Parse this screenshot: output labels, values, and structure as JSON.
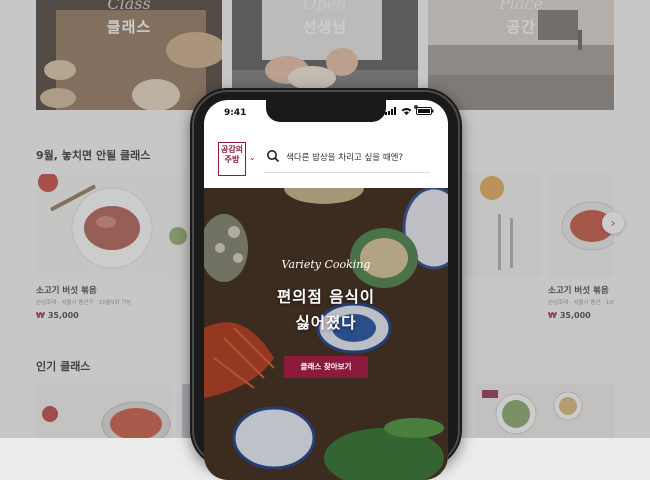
{
  "banner": [
    {
      "script": "Class",
      "title": "클래스"
    },
    {
      "script": "Open",
      "title": "선생님"
    },
    {
      "script": "Place",
      "title": "공간"
    }
  ],
  "section1": {
    "title": "9월, 놓치면 안될 클래스",
    "cards": [
      {
        "title": "소고기 버섯 볶음",
        "meta": "손님조태 · 서울시 용산구 · 10월5화 가능",
        "price": "35,000",
        "currency": "₩"
      },
      {
        "title": "소고기 버섯 볶음",
        "meta": "손님조태 · 서울시 용산 · 10월5화 가능",
        "price": "35,000",
        "currency": "₩"
      }
    ]
  },
  "section2": {
    "title": "인기 클래스"
  },
  "phone": {
    "time": "9:41",
    "logo": "공감의\n주방",
    "search_placeholder": "색다른 밥상을 차리고 싶을 때엔?",
    "hero_script": "Variety Cooking",
    "hero_line1": "편의점 음식이",
    "hero_line2": "싫어졌다",
    "hero_button": "클래스 찾아보기"
  },
  "colors": {
    "brand": "#8c1a3c"
  },
  "icons": {
    "next": "chevron-right-icon",
    "search": "search-icon",
    "caret": "chevron-down-icon"
  }
}
